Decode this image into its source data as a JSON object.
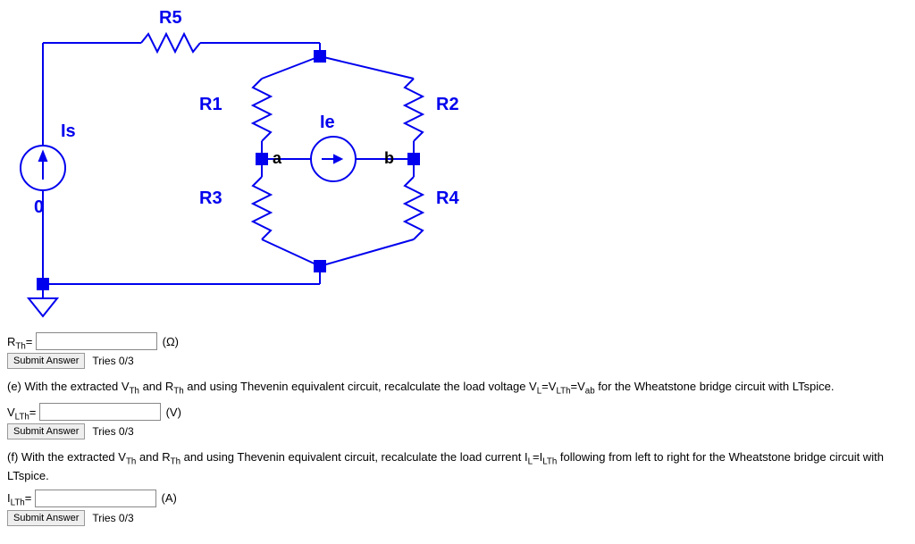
{
  "circuit": {
    "labels": {
      "R5": "R5",
      "R1": "R1",
      "R2": "R2",
      "R3": "R3",
      "R4": "R4",
      "Is": "Is",
      "Ie": "Ie",
      "node_a": "a",
      "node_b": "b",
      "ground": "0"
    }
  },
  "q_rth": {
    "label_var": "R",
    "label_sub": "Th",
    "eq": "=",
    "unit": "(Ω)",
    "submit": "Submit Answer",
    "tries": "Tries 0/3"
  },
  "q_e": {
    "prose_prefix": "(e) With the extracted V",
    "prose_sub1": "Th",
    "prose_mid1": " and R",
    "prose_sub2": "Th",
    "prose_mid2": " and using Thevenin equivalent circuit, recalculate the load voltage V",
    "prose_sub3": "L",
    "prose_mid3": "=V",
    "prose_sub4": "LTh",
    "prose_mid4": "=V",
    "prose_sub5": "ab",
    "prose_end": " for the Wheatstone bridge circuit with LTspice.",
    "label_var": "V",
    "label_sub": "LTh",
    "eq": "=",
    "unit": "(V)",
    "submit": "Submit Answer",
    "tries": "Tries 0/3"
  },
  "q_f": {
    "prose_prefix": "(f) With the extracted V",
    "prose_sub1": "Th",
    "prose_mid1": " and R",
    "prose_sub2": "Th",
    "prose_mid2": " and using Thevenin equivalent circuit, recalculate the load current I",
    "prose_sub3": "L",
    "prose_mid3": "=I",
    "prose_sub4": "LTh",
    "prose_end": " following from left to right for the Wheatstone bridge circuit with LTspice.",
    "label_var": "I",
    "label_sub": "LTh",
    "eq": "=",
    "unit": "(A)",
    "submit": "Submit Answer",
    "tries": "Tries 0/3"
  }
}
